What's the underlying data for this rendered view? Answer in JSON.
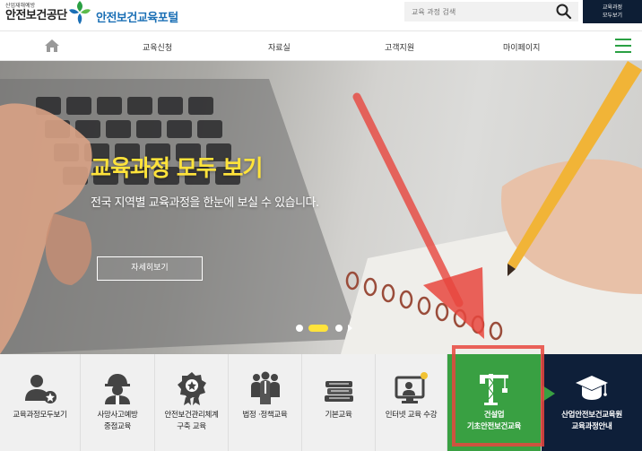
{
  "header": {
    "logo_small": "산업재해예방",
    "logo_main": "안전보건공단",
    "portal_title": "안전보건교육포털",
    "search_placeholder": "교육 과정 검색",
    "all_courses_line1": "교육과정",
    "all_courses_line2": "모두보기"
  },
  "nav": {
    "items": [
      "교육신청",
      "자료실",
      "고객지원",
      "마이페이지"
    ]
  },
  "hero": {
    "title": "교육과정 모두 보기",
    "subtitle": "전국 지역별 교육과정을 한눈에 보실 수 있습니다.",
    "button_label": "자세히보기",
    "slide_count": 3,
    "active_slide": 2
  },
  "quick_menu": {
    "items": [
      {
        "label_line1": "교육과정모두보기",
        "label_line2": "",
        "icon": "user-star-icon"
      },
      {
        "label_line1": "사망사고예방",
        "label_line2": "중점교육",
        "icon": "worker-helmet-icon"
      },
      {
        "label_line1": "안전보건관리체계",
        "label_line2": "구축 교육",
        "icon": "award-badge-icon"
      },
      {
        "label_line1": "법정 ·정책교육",
        "label_line2": "",
        "icon": "people-group-icon"
      },
      {
        "label_line1": "기본교육",
        "label_line2": "",
        "icon": "books-stack-icon"
      },
      {
        "label_line1": "인터넷 교육 수강",
        "label_line2": "",
        "icon": "online-learning-icon"
      },
      {
        "label_line1": "건설업",
        "label_line2": "기초안전보건교육",
        "icon": "crane-icon"
      },
      {
        "label_line1": "산업안전보건교육원",
        "label_line2": "교육과정안내",
        "icon": "graduation-cap-icon"
      }
    ]
  },
  "colors": {
    "brand_blue": "#1a6fb5",
    "brand_green": "#39a042",
    "navy": "#0e1f39",
    "hero_title_yellow": "#ffe33b",
    "annotation_red": "#e8463e"
  }
}
